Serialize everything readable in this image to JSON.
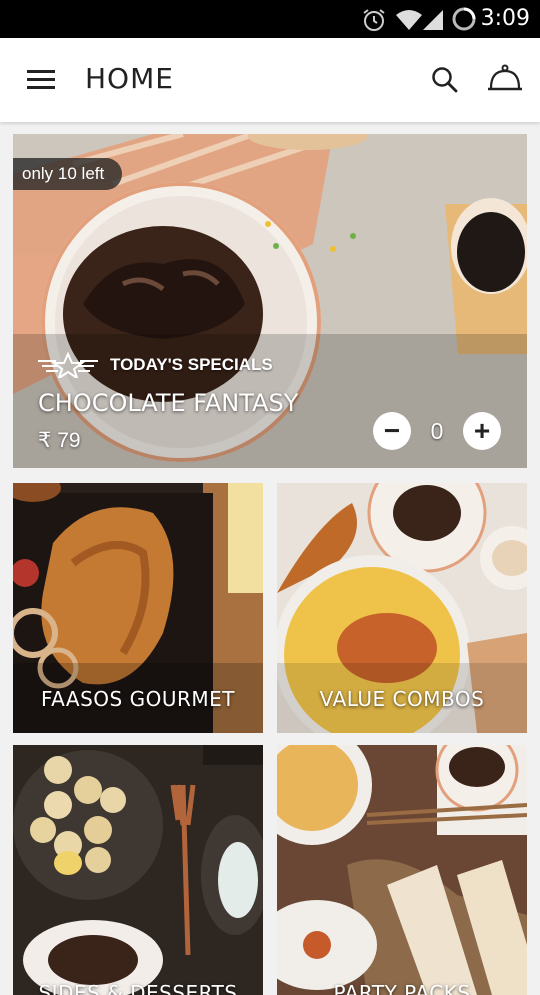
{
  "status_bar": {
    "time": "3:09",
    "icons": [
      "alarm-icon",
      "wifi-icon",
      "signal-icon",
      "battery-icon"
    ]
  },
  "app_bar": {
    "title": "HOME",
    "menu_icon": "hamburger-menu-icon",
    "search_icon": "search-icon",
    "cart_icon": "cloche-icon"
  },
  "hero": {
    "stock_badge": "only 10 left",
    "section_label": "TODAY'S SPECIALS",
    "item_name": "CHOCOLATE FANTASY",
    "price": "₹ 79",
    "quantity": "0",
    "decrement_label": "−",
    "increment_label": "+"
  },
  "tiles": [
    {
      "label": "FAASOS GOURMET"
    },
    {
      "label": "VALUE COMBOS"
    },
    {
      "label": "SIDES & DESSERTS"
    },
    {
      "label": "PARTY PACKS"
    }
  ],
  "colors": {
    "status_bar": "#000000",
    "app_bar": "#ffffff",
    "page_bg": "#f1f1f1",
    "text_dark": "#222222"
  }
}
